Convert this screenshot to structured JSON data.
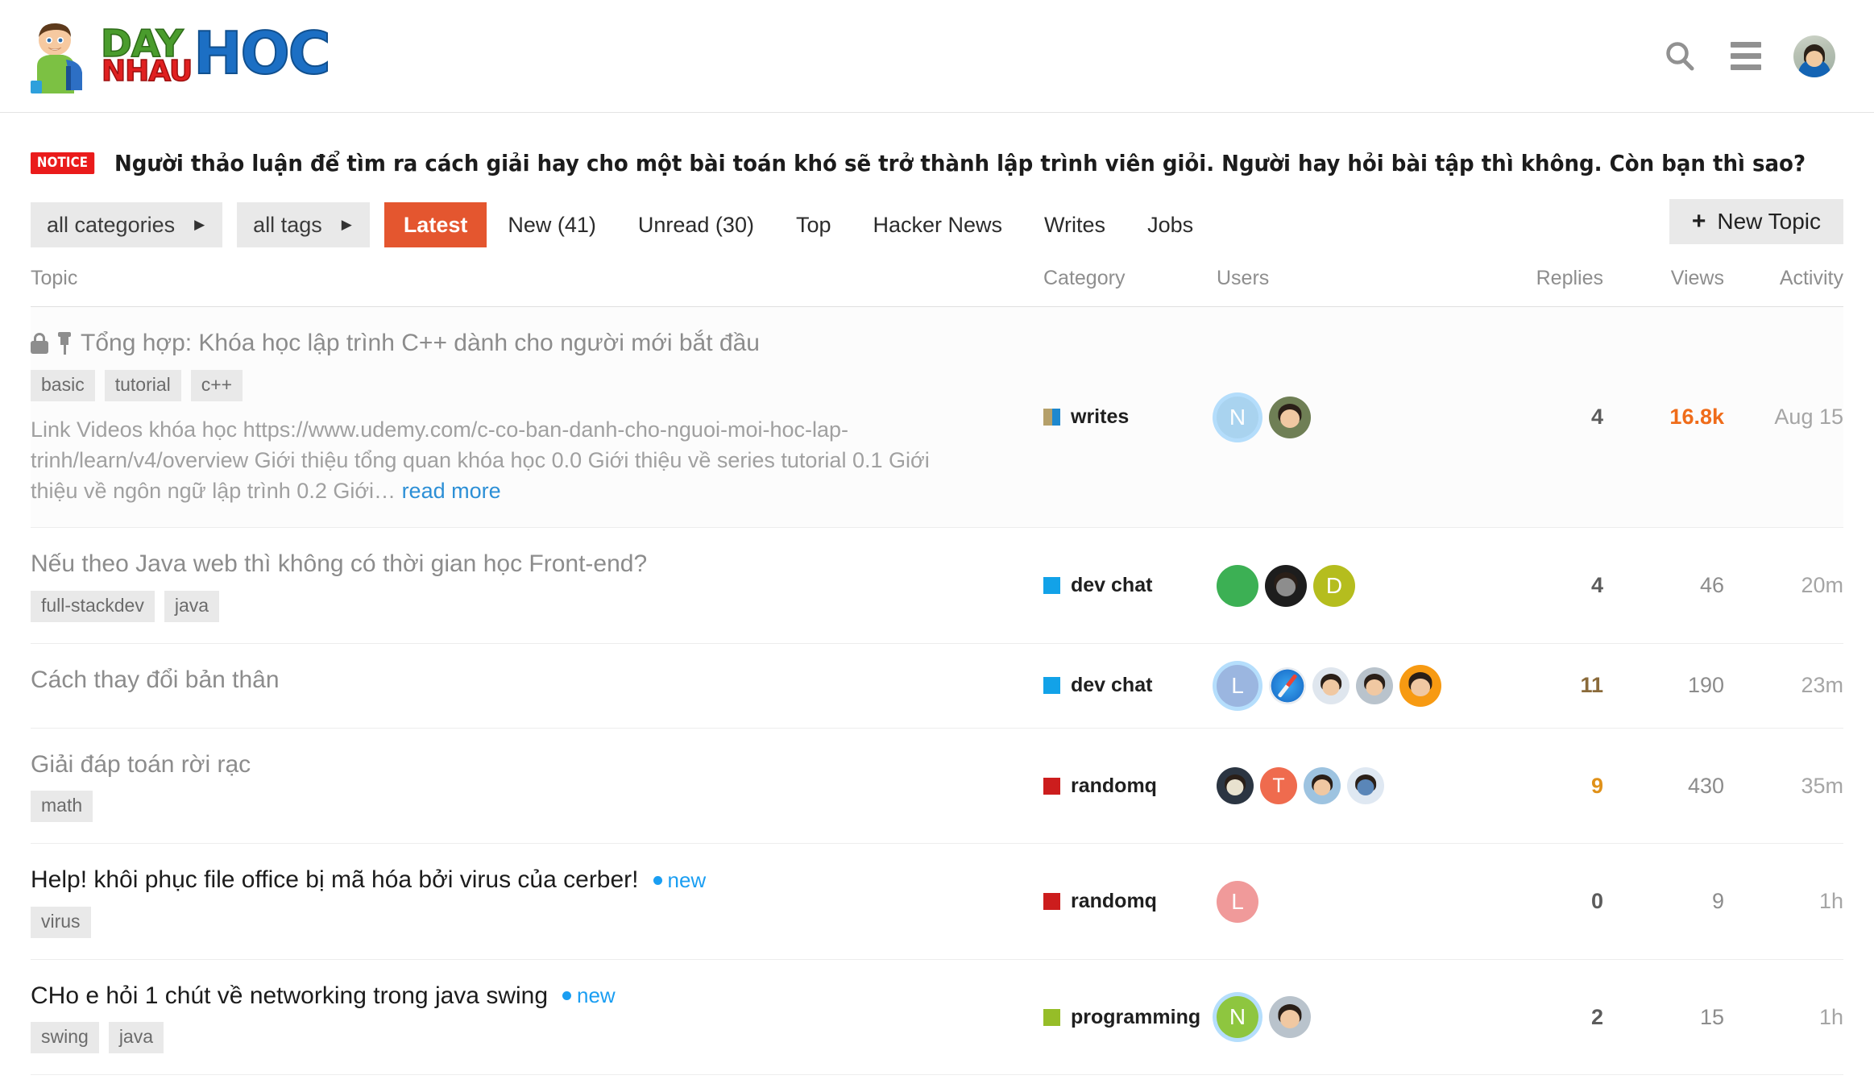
{
  "header": {
    "logo": {
      "part1": "DAY",
      "part2": "NHAU",
      "part3": "HOC",
      "mascot_icon": "student-boy-mascot"
    },
    "search_icon": "search-icon",
    "menu_icon": "hamburger-menu-icon",
    "avatar_icon": "user-avatar"
  },
  "notice": {
    "badge": "NOTICE",
    "text": "Người thảo luận để tìm ra cách giải hay cho một bài toán khó sẽ trở thành lập trình viên giỏi. Người hay hỏi bài tập thì không. Còn bạn thì sao?"
  },
  "nav": {
    "categories_label": "all categories",
    "tags_label": "all tags",
    "caret_icon": "chevron-right-icon",
    "tabs": [
      {
        "label": "Latest",
        "active": true
      },
      {
        "label": "New (41)",
        "active": false
      },
      {
        "label": "Unread (30)",
        "active": false
      },
      {
        "label": "Top",
        "active": false
      },
      {
        "label": "Hacker News",
        "active": false
      },
      {
        "label": "Writes",
        "active": false
      },
      {
        "label": "Jobs",
        "active": false
      }
    ],
    "new_topic_label": "New Topic",
    "new_topic_plus": "+"
  },
  "table": {
    "headers": {
      "topic": "Topic",
      "category": "Category",
      "users": "Users",
      "replies": "Replies",
      "views": "Views",
      "activity": "Activity"
    },
    "rows": [
      {
        "title": "Tổng hợp: Khóa học lập trình C++ dành cho người mới bắt đầu",
        "tags": [
          "basic",
          "tutorial",
          "c++"
        ],
        "excerpt": "Link Videos khóa học https://www.udemy.com/c-co-ban-danh-cho-nguoi-moi-hoc-lap-trinh/learn/v4/overview Giới thiệu tổng quan khóa học 0.0 Giới thiệu về series tutorial 0.1 Giới thiệu về ngôn ngữ lập trình 0.2 Giới…",
        "read_more": "read more",
        "category": "writes",
        "replies": "4",
        "views": "16.8k",
        "activity": "Aug 15"
      },
      {
        "title": "Nếu theo Java web thì không có thời gian học Front-end?",
        "tags": [
          "full-stackdev",
          "java"
        ],
        "category": "dev chat",
        "replies": "4",
        "views": "46",
        "activity": "20m"
      },
      {
        "title": "Cách thay đổi bản thân",
        "tags": [],
        "category": "dev chat",
        "replies": "11",
        "views": "190",
        "activity": "23m"
      },
      {
        "title": "Giải đáp toán rời rạc",
        "tags": [
          "math"
        ],
        "category": "randomq",
        "replies": "9",
        "views": "430",
        "activity": "35m"
      },
      {
        "title": "Help! khôi phục file office bị mã hóa bởi virus của cerber!",
        "new_label": "new",
        "tags": [
          "virus"
        ],
        "category": "randomq",
        "replies": "0",
        "views": "9",
        "activity": "1h"
      },
      {
        "title": "CHo e hỏi 1 chút về networking trong java swing",
        "new_label": "new",
        "tags": [
          "swing",
          "java"
        ],
        "category": "programming",
        "replies": "2",
        "views": "15",
        "activity": "1h"
      }
    ]
  },
  "colors": {
    "accent_orange": "#e4562f",
    "link_blue": "#2c8fd6",
    "new_blue": "#1a9ef2",
    "notice_red": "#ea1b1b",
    "views_hot": "#ef6c1a",
    "cat_writes_a": "#b5a06a",
    "cat_writes_b": "#1e88ce",
    "cat_devchat": "#12a2e8",
    "cat_randomq": "#cc1d1d",
    "cat_programming": "#96bd28"
  },
  "avatar_initials": {
    "r1a": "N",
    "r2c": "D",
    "r3a": "L",
    "r4b": "T",
    "r5a": "L",
    "r6a": "N"
  }
}
